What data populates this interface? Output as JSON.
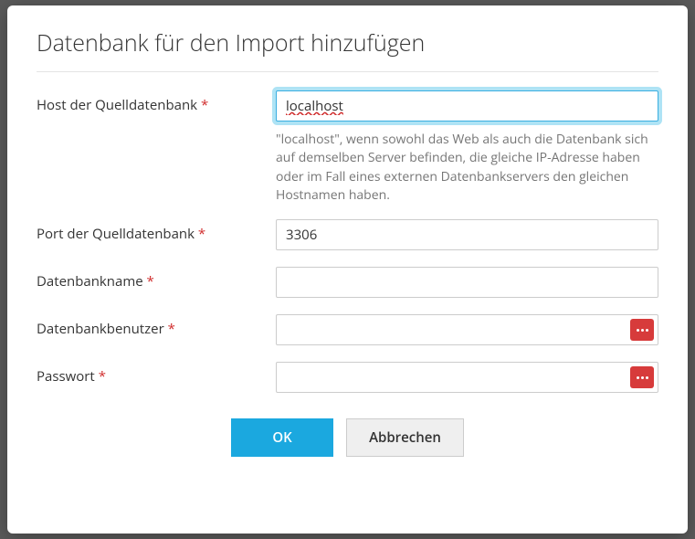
{
  "title": "Datenbank für den Import hinzufügen",
  "fields": {
    "host": {
      "label": "Host der Quelldatenbank",
      "required": true,
      "value": "localhost",
      "hint": "\"localhost\", wenn sowohl das Web als auch die Datenbank sich auf demselben Server befinden, die gleiche IP-Adresse haben oder im Fall eines externen Datenbankservers den gleichen Hostnamen haben."
    },
    "port": {
      "label": "Port der Quelldatenbank",
      "required": true,
      "value": "3306"
    },
    "dbname": {
      "label": "Datenbankname",
      "required": true,
      "value": ""
    },
    "dbuser": {
      "label": "Datenbankbenutzer",
      "required": true,
      "value": ""
    },
    "password": {
      "label": "Passwort",
      "required": true,
      "value": ""
    }
  },
  "buttons": {
    "ok": "OK",
    "cancel": "Abbrechen"
  },
  "required_marker": "*"
}
